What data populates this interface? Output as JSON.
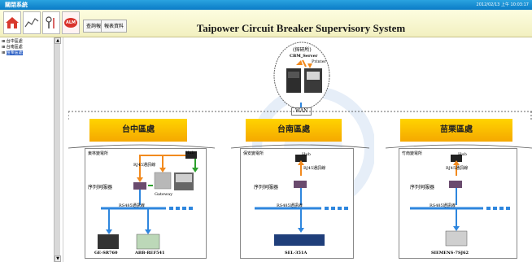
{
  "window": {
    "title": "關閉系統",
    "datetime": "2012/02/13 上午 10:03:17"
  },
  "toolbar": {
    "icons": [
      "home-icon",
      "chart-icon",
      "tools-icon",
      "alarm-icon"
    ],
    "alarm_badge": "ALM",
    "btn_query": "查詢報",
    "btn_report": "報表資料"
  },
  "header": {
    "title": "Taipower Circuit Breaker Supervisory System"
  },
  "sidebar": {
    "items": [
      "台中區處",
      "台南區處",
      "苗栗區處"
    ]
  },
  "center": {
    "label": "(探研所)",
    "server_label": "CBM_Server",
    "printer_label": "Printer",
    "wan_label": "WAN"
  },
  "regions": [
    {
      "name": "台中區處",
      "station": "東林變電所",
      "hub": "Hub",
      "link_label": "RJ45通訊線",
      "controller": "序列伺服器",
      "gateway": "Gateway",
      "devices": [
        "GE-SR760",
        "ABB-REF541"
      ]
    },
    {
      "name": "台南區處",
      "station": "保安變電所",
      "hub": "Hub",
      "link_label": "RJ45通訊線",
      "controller": "序列伺服器",
      "devices": [
        "SEL-351A"
      ]
    },
    {
      "name": "苗栗區處",
      "station": "竹南變電所",
      "hub": "Hub",
      "link_label": "RJ45通訊線",
      "controller": "序列伺服器",
      "devices": [
        "SIEMENS-7SJ62"
      ]
    }
  ],
  "bus_label": "RS485通訊線",
  "colors": {
    "title_blue": "#0a7bc6",
    "region_yellow": "#f5b800",
    "link_orange": "#f28a1e",
    "link_green": "#2ca02c",
    "bus_blue": "#2e86de"
  }
}
